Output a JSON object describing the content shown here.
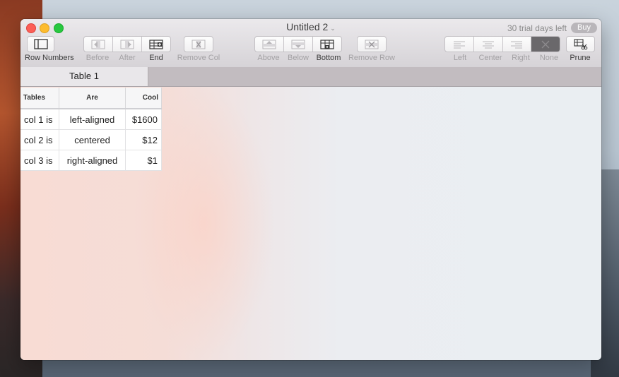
{
  "window": {
    "title": "Untitled 2",
    "title_chevron": "⌄",
    "trial_text": "30 trial days left",
    "buy_label": "Buy"
  },
  "toolbar": {
    "row_numbers": "Row Numbers",
    "col_before": "Before",
    "col_after": "After",
    "col_end": "End",
    "remove_col": "Remove Col",
    "row_above": "Above",
    "row_below": "Below",
    "row_bottom": "Bottom",
    "remove_row": "Remove Row",
    "align_left": "Left",
    "align_center": "Center",
    "align_right": "Right",
    "align_none": "None",
    "prune": "Prune"
  },
  "tabs": [
    {
      "label": "Table 1"
    }
  ],
  "table": {
    "headers": [
      "Tables",
      "Are",
      "Cool"
    ],
    "rows": [
      [
        "col 1 is",
        "left-aligned",
        "$1600"
      ],
      [
        "col 2 is",
        "centered",
        "$12"
      ],
      [
        "col 3 is",
        "right-aligned",
        "$1"
      ]
    ]
  },
  "colors": {
    "close": "#fc5f57",
    "minimize": "#fdbc2e",
    "maximize": "#28c840",
    "selected_segment": "#6a686b"
  }
}
